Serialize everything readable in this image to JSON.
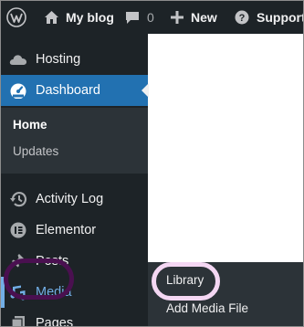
{
  "admin_bar": {
    "site_name": "My blog",
    "comments_count": "0",
    "new_label": "New",
    "support_label": "Support"
  },
  "sidebar": {
    "items": [
      {
        "label": "Hosting",
        "icon": "cloud-icon"
      },
      {
        "label": "Dashboard",
        "icon": "dashboard-icon"
      },
      {
        "label": "Activity Log",
        "icon": "history-icon"
      },
      {
        "label": "Elementor",
        "icon": "elementor-icon"
      },
      {
        "label": "Posts",
        "icon": "pin-icon"
      },
      {
        "label": "Media",
        "icon": "media-icon"
      },
      {
        "label": "Pages",
        "icon": "page-icon"
      }
    ],
    "dashboard_submenu": [
      {
        "label": "Home"
      },
      {
        "label": "Updates"
      }
    ]
  },
  "media_flyout": {
    "items": [
      {
        "label": "Library"
      },
      {
        "label": "Add Media File"
      }
    ]
  },
  "colors": {
    "admin_bg": "#1d2327",
    "accent": "#2271b1",
    "media_highlight": "#72aee6",
    "sidebar_highlight_ring": "#4a1050",
    "flyout_highlight_ring": "#f4d7f3"
  }
}
